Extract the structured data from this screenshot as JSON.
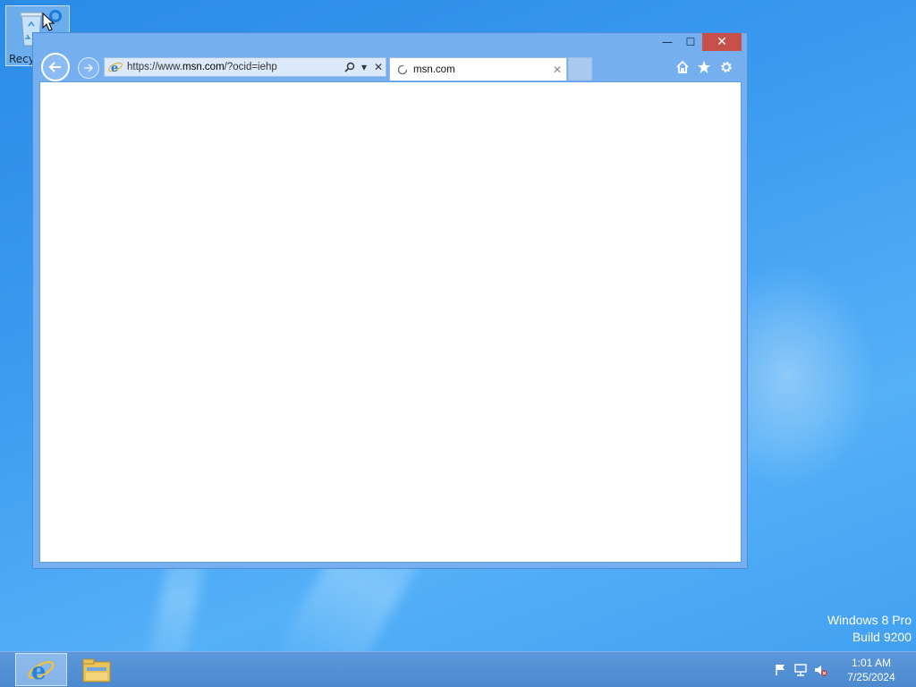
{
  "desktop": {
    "icons": [
      {
        "label": "Recy",
        "icon": "recycle-bin-icon"
      }
    ],
    "watermark": {
      "line1": "Windows 8 Pro",
      "line2": "Build 9200"
    }
  },
  "browser": {
    "window_controls": {
      "minimize": "—",
      "maximize": "☐",
      "close": "✕"
    },
    "address": {
      "url_prefix": "https://www.",
      "url_host": "msn.com",
      "url_suffix": "/?ocid=iehp",
      "search_glyph": "⚲",
      "dropdown_glyph": "▾",
      "stop_glyph": "✕"
    },
    "tabs": [
      {
        "title": "msn.com",
        "loading": true,
        "close_glyph": "✕"
      }
    ],
    "commands": {
      "home": "home-icon",
      "favorites": "star-icon",
      "tools": "gear-icon"
    }
  },
  "taskbar": {
    "apps": [
      {
        "name": "Internet Explorer",
        "icon": "internet-explorer-icon",
        "active": true
      },
      {
        "name": "File Explorer",
        "icon": "file-explorer-icon",
        "active": false
      }
    ],
    "tray": {
      "icons": [
        "action-center-flag-icon",
        "network-icon",
        "volume-muted-icon"
      ]
    },
    "clock": {
      "time": "1:01 AM",
      "date": "7/25/2024"
    }
  },
  "colors": {
    "desktop_accent": "#3a9af0",
    "window_frame": "#76aff0",
    "close_button": "#c7504a",
    "taskbar": "#5b97d9"
  }
}
